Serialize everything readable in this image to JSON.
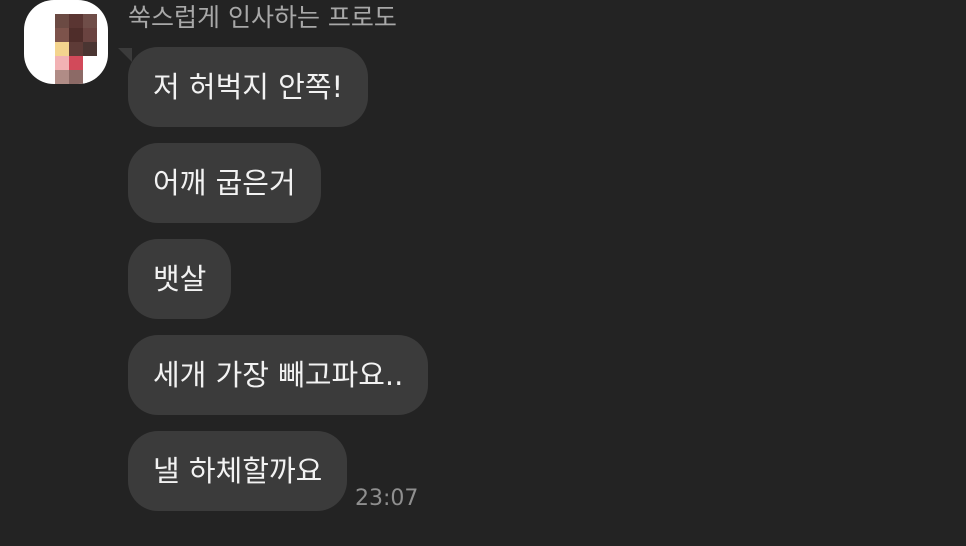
{
  "chat": {
    "sender_name": "쑥스럽게 인사하는 프로도",
    "messages": [
      {
        "text": "저 허벅지 안쪽!"
      },
      {
        "text": "어깨 굽은거"
      },
      {
        "text": "뱃살"
      },
      {
        "text": "세개 가장 빼고파요.."
      },
      {
        "text": "낼 하체할까요"
      }
    ],
    "last_timestamp": "23:07"
  },
  "colors": {
    "background": "#232323",
    "bubble": "#3b3b3b",
    "bubble_text": "#f2f2f2",
    "sender_text": "#a8a8a8",
    "timestamp_text": "#8f8f8f"
  },
  "avatar": {
    "icon": "pixelated-profile-avatar"
  }
}
